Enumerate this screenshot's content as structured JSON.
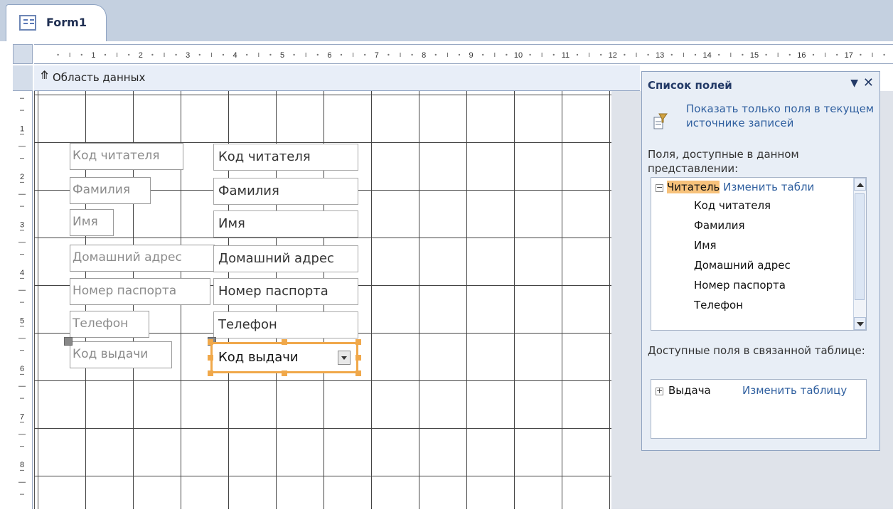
{
  "window": {
    "tab_title": "Form1"
  },
  "ruler": {
    "horizontal_numbers": [
      "1",
      "2",
      "3",
      "4",
      "5",
      "6",
      "7",
      "8",
      "9",
      "10",
      "11",
      "12",
      "13",
      "14",
      "15",
      "16",
      "17"
    ],
    "vertical_numbers": [
      "1",
      "2",
      "3",
      "4",
      "5",
      "6",
      "7",
      "8"
    ]
  },
  "designer": {
    "section_title": "Область данных",
    "labels": [
      "Код читателя",
      "Фамилия",
      "Имя",
      "Домашний адрес",
      "Номер паспорта",
      "Телефон",
      "Код выдачи"
    ],
    "fields": [
      "Код читателя",
      "Фамилия",
      "Имя",
      "Домашний адрес",
      "Номер паспорта",
      "Телефон"
    ],
    "combo": {
      "value": "Код выдачи"
    }
  },
  "field_list": {
    "title": "Список полей",
    "filter_link": "Показать только поля в текущем источнике записей",
    "available_label": "Поля, доступные в данном представлении:",
    "table_name": "Читатель",
    "edit_table_link": "Изменить табли",
    "fields": [
      "Код читателя",
      "Фамилия",
      "Имя",
      "Домашний адрес",
      "Номер паспорта",
      "Телефон"
    ],
    "related_label": "Доступные поля в связанной таблице:",
    "related_table": "Выдача",
    "related_edit_link": "Изменить таблицу"
  }
}
